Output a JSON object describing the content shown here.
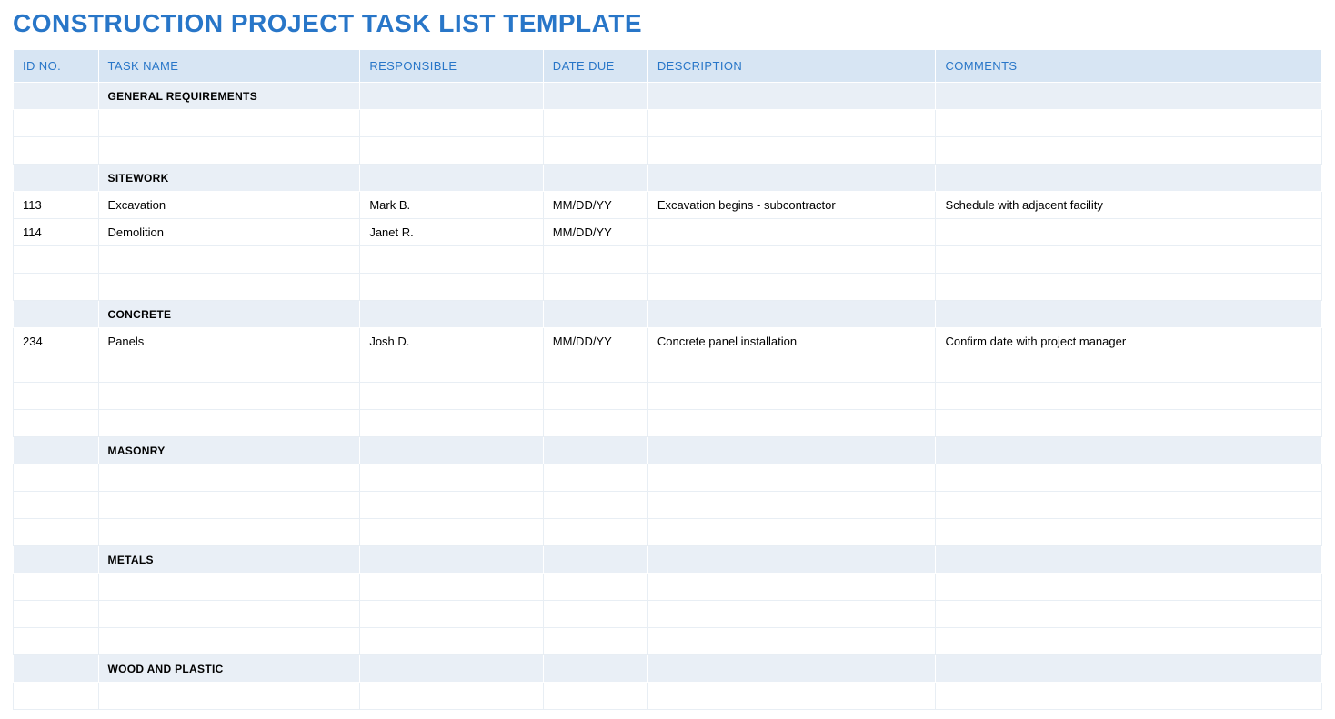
{
  "title": "CONSTRUCTION PROJECT TASK LIST TEMPLATE",
  "columns": {
    "id": "ID NO.",
    "task": "TASK NAME",
    "responsible": "RESPONSIBLE",
    "due": "DATE DUE",
    "description": "DESCRIPTION",
    "comments": "COMMENTS"
  },
  "sections": [
    {
      "name": "GENERAL REQUIREMENTS",
      "rows": [
        {
          "id": "",
          "task": "",
          "responsible": "",
          "due": "",
          "description": "",
          "comments": ""
        },
        {
          "id": "",
          "task": "",
          "responsible": "",
          "due": "",
          "description": "",
          "comments": ""
        }
      ]
    },
    {
      "name": "SITEWORK",
      "rows": [
        {
          "id": "113",
          "task": "Excavation",
          "responsible": "Mark B.",
          "due": "MM/DD/YY",
          "description": "Excavation begins - subcontractor",
          "comments": "Schedule with adjacent facility"
        },
        {
          "id": "114",
          "task": "Demolition",
          "responsible": "Janet R.",
          "due": "MM/DD/YY",
          "description": "",
          "comments": ""
        },
        {
          "id": "",
          "task": "",
          "responsible": "",
          "due": "",
          "description": "",
          "comments": ""
        },
        {
          "id": "",
          "task": "",
          "responsible": "",
          "due": "",
          "description": "",
          "comments": ""
        }
      ]
    },
    {
      "name": "CONCRETE",
      "rows": [
        {
          "id": "234",
          "task": "Panels",
          "responsible": "Josh D.",
          "due": "MM/DD/YY",
          "description": "Concrete panel installation",
          "comments": "Confirm date with project manager"
        },
        {
          "id": "",
          "task": "",
          "responsible": "",
          "due": "",
          "description": "",
          "comments": ""
        },
        {
          "id": "",
          "task": "",
          "responsible": "",
          "due": "",
          "description": "",
          "comments": ""
        },
        {
          "id": "",
          "task": "",
          "responsible": "",
          "due": "",
          "description": "",
          "comments": ""
        }
      ]
    },
    {
      "name": "MASONRY",
      "rows": [
        {
          "id": "",
          "task": "",
          "responsible": "",
          "due": "",
          "description": "",
          "comments": ""
        },
        {
          "id": "",
          "task": "",
          "responsible": "",
          "due": "",
          "description": "",
          "comments": ""
        },
        {
          "id": "",
          "task": "",
          "responsible": "",
          "due": "",
          "description": "",
          "comments": ""
        }
      ]
    },
    {
      "name": "METALS",
      "rows": [
        {
          "id": "",
          "task": "",
          "responsible": "",
          "due": "",
          "description": "",
          "comments": ""
        },
        {
          "id": "",
          "task": "",
          "responsible": "",
          "due": "",
          "description": "",
          "comments": ""
        },
        {
          "id": "",
          "task": "",
          "responsible": "",
          "due": "",
          "description": "",
          "comments": ""
        }
      ]
    },
    {
      "name": "WOOD AND PLASTIC",
      "rows": [
        {
          "id": "",
          "task": "",
          "responsible": "",
          "due": "",
          "description": "",
          "comments": ""
        }
      ]
    }
  ]
}
